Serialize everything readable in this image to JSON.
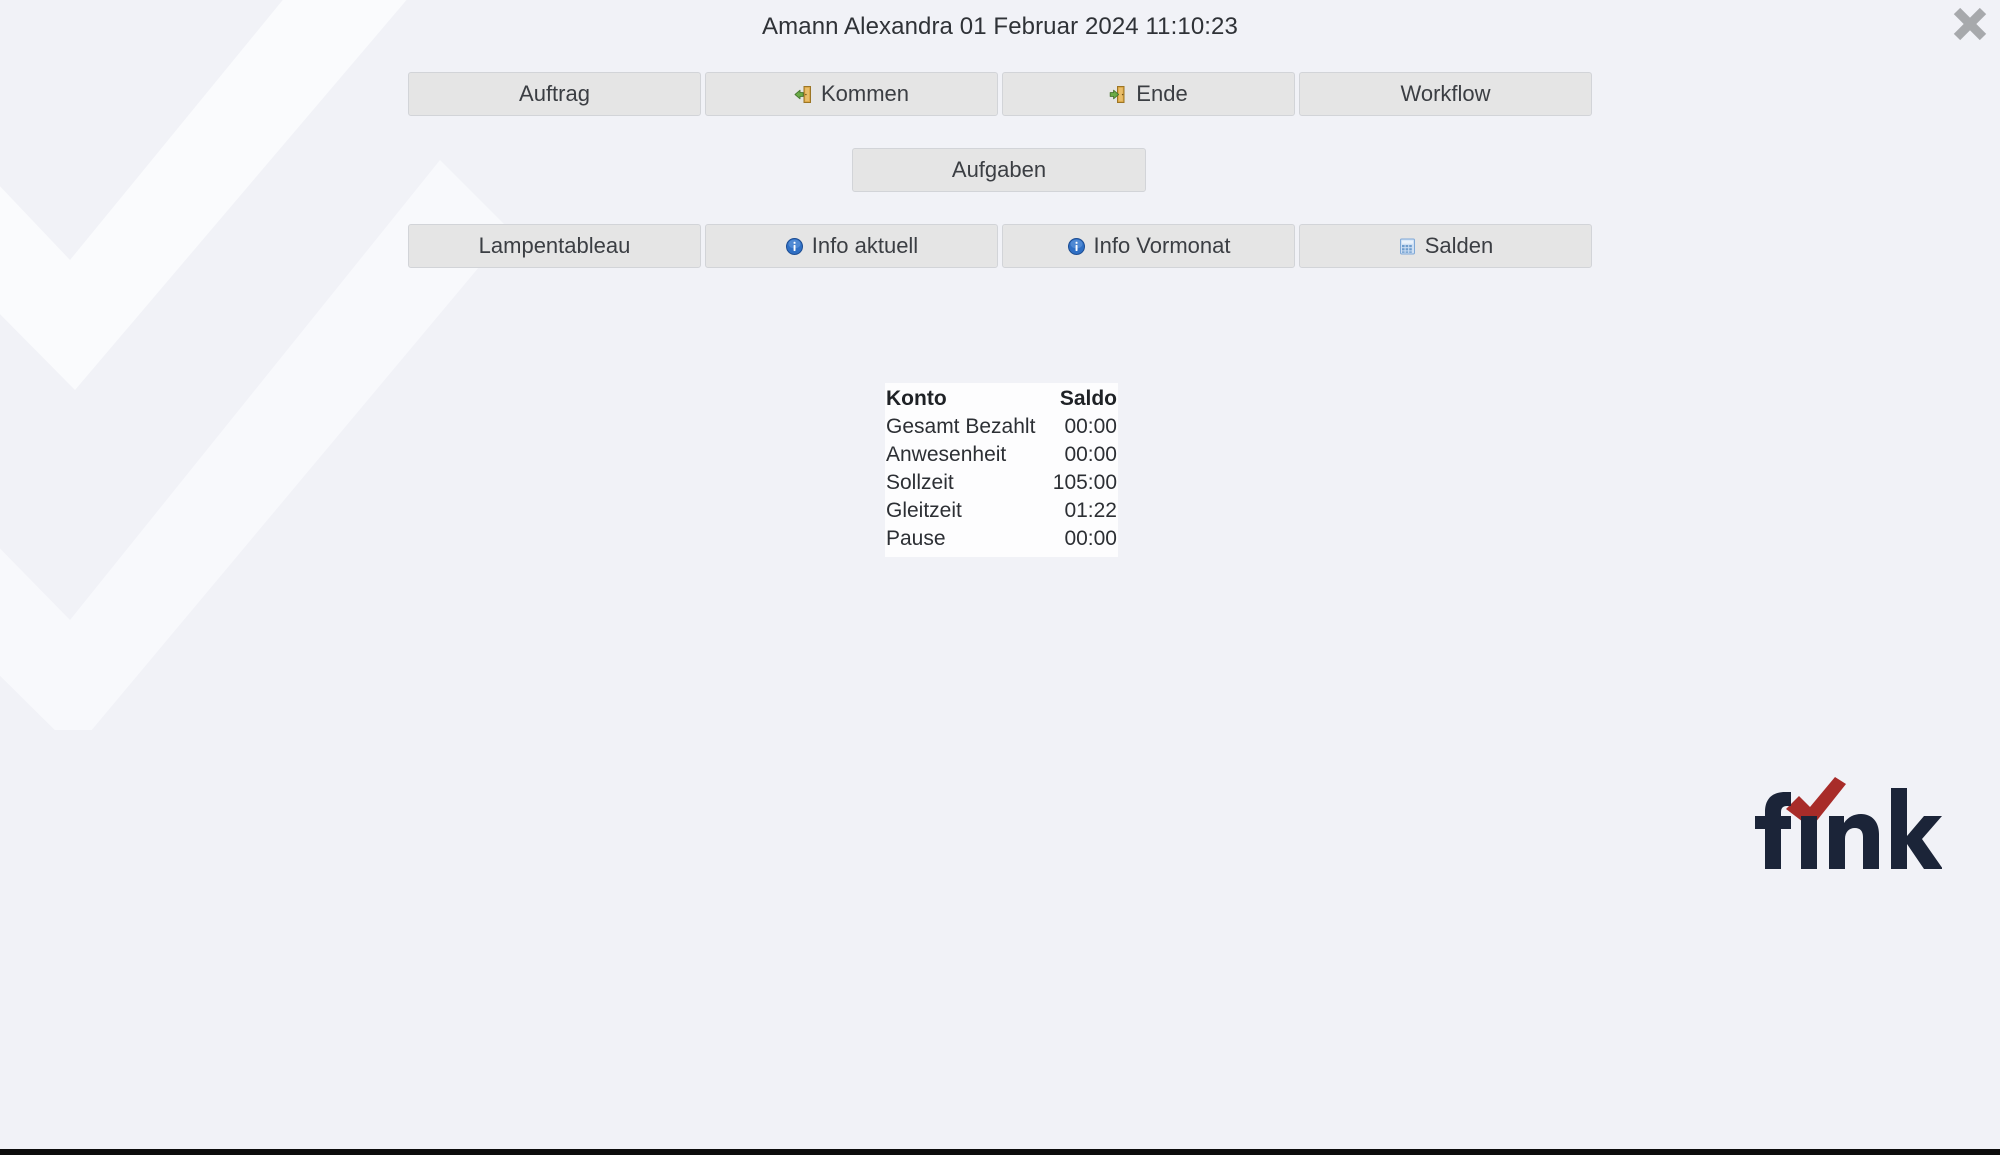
{
  "window": {
    "close_icon": "close-x-icon",
    "background_color": "#f1f2f7",
    "accent_color": "#1b2438",
    "check_color": "#b02a28"
  },
  "header": {
    "title": "Amann Alexandra 01 Februar 2024 11:10:23",
    "person": "Amann Alexandra",
    "date": "01 Februar 2024",
    "time": "11:10:23"
  },
  "actions": {
    "row1": [
      {
        "label": "Auftrag",
        "icon": null,
        "name": "auftrag-button"
      },
      {
        "label": "Kommen",
        "icon": "door-enter-icon",
        "name": "kommen-button"
      },
      {
        "label": "Ende",
        "icon": "door-exit-icon",
        "name": "ende-button"
      },
      {
        "label": "Workflow",
        "icon": null,
        "name": "workflow-button"
      }
    ],
    "row2": [
      {
        "label": "Aufgaben",
        "icon": null,
        "name": "aufgaben-button"
      }
    ],
    "row3": [
      {
        "label": "Lampentableau",
        "icon": null,
        "name": "lampentableau-button"
      },
      {
        "label": "Info aktuell",
        "icon": "info-circle-icon",
        "name": "info-aktuell-button"
      },
      {
        "label": "Info Vormonat",
        "icon": "info-circle-icon",
        "name": "info-vormonat-button"
      },
      {
        "label": "Salden",
        "icon": "table-grid-icon",
        "name": "salden-button"
      }
    ]
  },
  "saldo_table": {
    "headers": [
      "Konto",
      "Saldo"
    ],
    "rows": [
      {
        "konto": "Gesamt Bezahlt",
        "saldo": "00:00"
      },
      {
        "konto": "Anwesenheit",
        "saldo": "00:00"
      },
      {
        "konto": "Sollzeit",
        "saldo": "105:00"
      },
      {
        "konto": "Gleitzeit",
        "saldo": "01:22"
      },
      {
        "konto": "Pause",
        "saldo": "00:00"
      }
    ]
  },
  "logo": {
    "text": "fink",
    "mark": "check-mark-icon"
  }
}
